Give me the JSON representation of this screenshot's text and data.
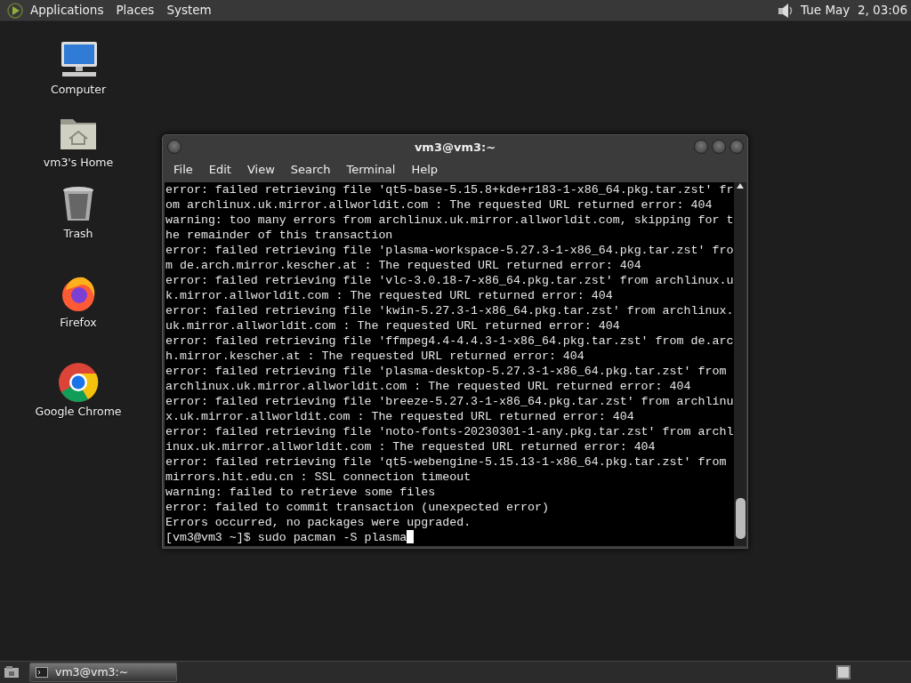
{
  "top_panel": {
    "menus": [
      "Applications",
      "Places",
      "System"
    ],
    "clock": "Tue May  2, 03:06"
  },
  "desktop_icons": [
    {
      "label": "Computer",
      "kind": "computer"
    },
    {
      "label": "vm3's Home",
      "kind": "home"
    },
    {
      "label": "Trash",
      "kind": "trash"
    },
    {
      "label": "Firefox",
      "kind": "firefox"
    },
    {
      "label": "Google Chrome",
      "kind": "chrome"
    }
  ],
  "terminal": {
    "title": "vm3@vm3:~",
    "menu": [
      "File",
      "Edit",
      "View",
      "Search",
      "Terminal",
      "Help"
    ],
    "lines": [
      "error: failed retrieving file 'qt5-base-5.15.8+kde+r183-1-x86_64.pkg.tar.zst' fr",
      "om archlinux.uk.mirror.allworldit.com : The requested URL returned error: 404",
      "warning: too many errors from archlinux.uk.mirror.allworldit.com, skipping for t",
      "he remainder of this transaction",
      "error: failed retrieving file 'plasma-workspace-5.27.3-1-x86_64.pkg.tar.zst' fro",
      "m de.arch.mirror.kescher.at : The requested URL returned error: 404",
      "error: failed retrieving file 'vlc-3.0.18-7-x86_64.pkg.tar.zst' from archlinux.u",
      "k.mirror.allworldit.com : The requested URL returned error: 404",
      "error: failed retrieving file 'kwin-5.27.3-1-x86_64.pkg.tar.zst' from archlinux.",
      "uk.mirror.allworldit.com : The requested URL returned error: 404",
      "error: failed retrieving file 'ffmpeg4.4-4.4.3-1-x86_64.pkg.tar.zst' from de.arc",
      "h.mirror.kescher.at : The requested URL returned error: 404",
      "error: failed retrieving file 'plasma-desktop-5.27.3-1-x86_64.pkg.tar.zst' from",
      "archlinux.uk.mirror.allworldit.com : The requested URL returned error: 404",
      "error: failed retrieving file 'breeze-5.27.3-1-x86_64.pkg.tar.zst' from archlinu",
      "x.uk.mirror.allworldit.com : The requested URL returned error: 404",
      "error: failed retrieving file 'noto-fonts-20230301-1-any.pkg.tar.zst' from archl",
      "inux.uk.mirror.allworldit.com : The requested URL returned error: 404",
      "error: failed retrieving file 'qt5-webengine-5.15.13-1-x86_64.pkg.tar.zst' from",
      "mirrors.hit.edu.cn : SSL connection timeout",
      "warning: failed to retrieve some files",
      "error: failed to commit transaction (unexpected error)",
      "Errors occurred, no packages were upgraded."
    ],
    "prompt": "[vm3@vm3 ~]$ sudo pacman -S plasma"
  },
  "taskbar": {
    "tasks": [
      {
        "label": "vm3@vm3:~",
        "selected": true
      }
    ]
  }
}
